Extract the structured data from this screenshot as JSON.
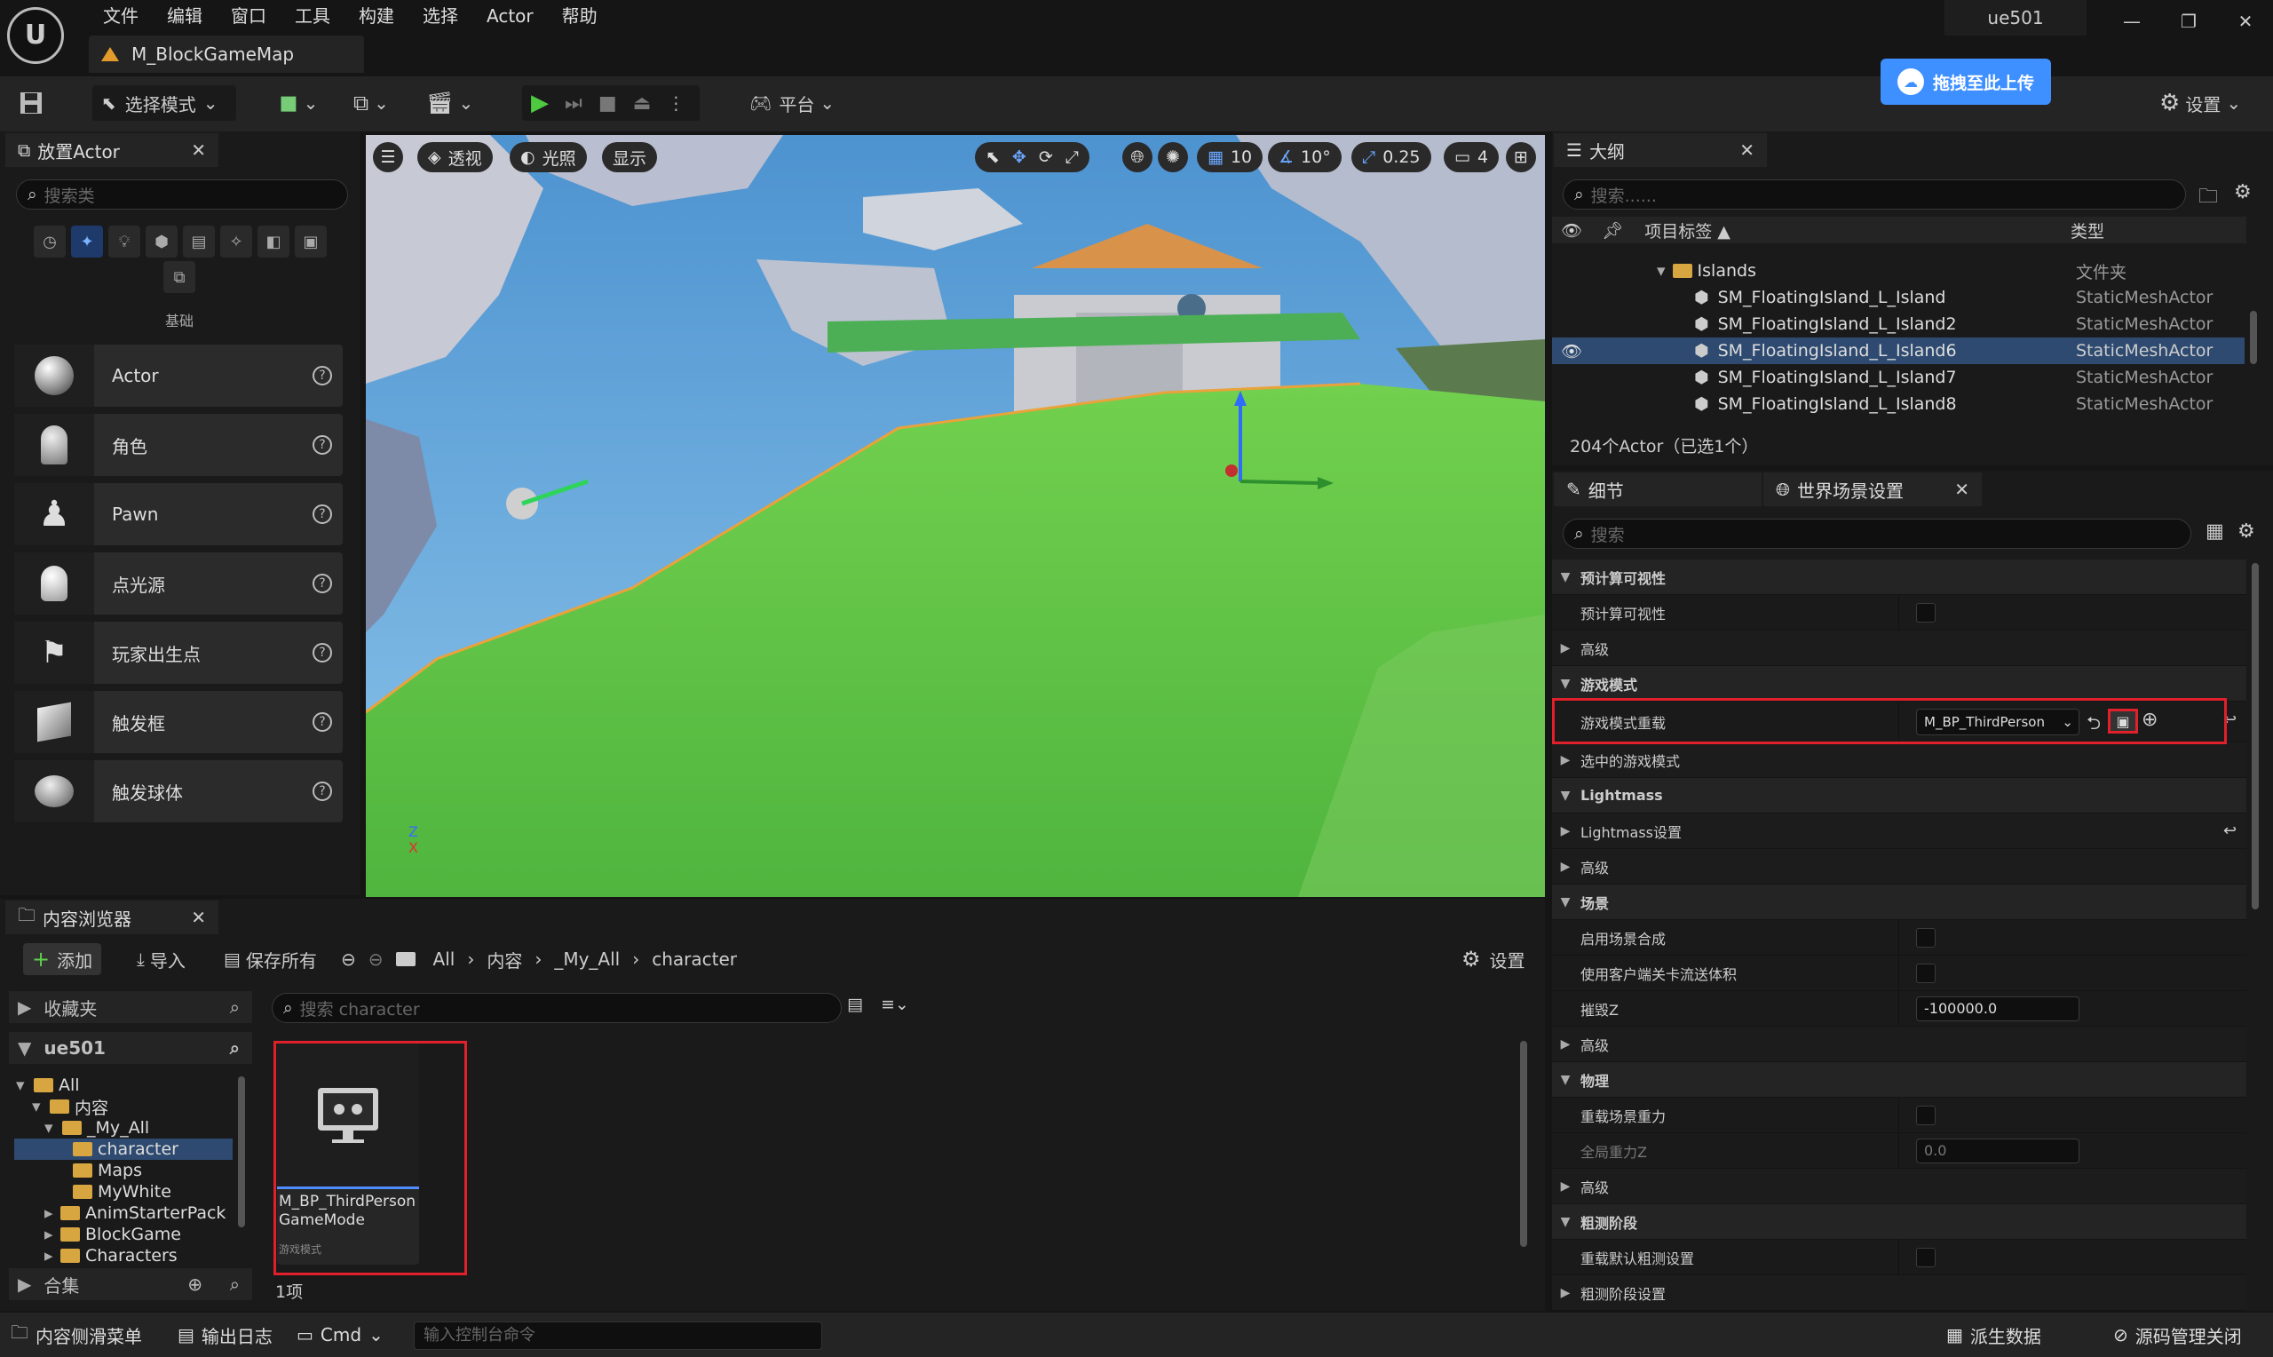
{
  "app": {
    "logo": "U",
    "map_tab": "M_BlockGameMap",
    "user": "ue501"
  },
  "menu": [
    "文件",
    "编辑",
    "窗口",
    "工具",
    "构建",
    "选择",
    "Actor",
    "帮助"
  ],
  "toolbar": {
    "select_mode": "选择模式",
    "platform": "平台",
    "settings": "设置",
    "upload": "拖拽至此上传"
  },
  "place_actor": {
    "tab": "放置Actor",
    "search_placeholder": "搜索类",
    "category_label": "基础",
    "items": [
      "Actor",
      "角色",
      "Pawn",
      "点光源",
      "玩家出生点",
      "触发框",
      "触发球体"
    ]
  },
  "viewport": {
    "perspective": "透视",
    "lighting": "光照",
    "show": "显示",
    "grid": "10",
    "angle": "10°",
    "scale": "0.25",
    "camera": "4"
  },
  "outliner": {
    "tab": "大纲",
    "search_placeholder": "搜索......",
    "col_label": "项目标签 ▲",
    "col_type": "类型",
    "folder": {
      "name": "Islands",
      "type": "文件夹"
    },
    "rows": [
      {
        "name": "SM_FloatingIsland_L_Island",
        "type": "StaticMeshActor"
      },
      {
        "name": "SM_FloatingIsland_L_Island2",
        "type": "StaticMeshActor"
      },
      {
        "name": "SM_FloatingIsland_L_Island6",
        "type": "StaticMeshActor"
      },
      {
        "name": "SM_FloatingIsland_L_Island7",
        "type": "StaticMeshActor"
      },
      {
        "name": "SM_FloatingIsland_L_Island8",
        "type": "StaticMeshActor"
      }
    ],
    "status": "204个Actor（已选1个）"
  },
  "details": {
    "tab": "细节",
    "world_tab": "世界场景设置",
    "search_placeholder": "搜索",
    "rows": {
      "precomp_vis": "预计算可视性",
      "precomp_vis_prop": "预计算可视性",
      "advanced1": "高级",
      "game_mode": "游戏模式",
      "game_mode_override": "游戏模式重载",
      "game_mode_value": "M_BP_ThirdPerson",
      "selected_game_mode": "选中的游戏模式",
      "lightmass": "Lightmass",
      "lightmass_settings": "Lightmass设置",
      "advanced2": "高级",
      "scene": "场景",
      "world_comp": "启用场景合成",
      "client_streaming": "使用客户端关卡流送体积",
      "kill_z": "摧毁Z",
      "kill_z_value": "-100000.0",
      "advanced3": "高级",
      "physics": "物理",
      "override_gravity": "重载场景重力",
      "global_gravity_z": "全局重力Z",
      "gravity_value": "0.0",
      "advanced4": "高级",
      "broadphase": "粗测阶段",
      "override_broadphase": "重载默认粗测设置",
      "broadphase_settings": "粗测阶段设置"
    }
  },
  "content_browser": {
    "tab": "内容浏览器",
    "add": "添加",
    "import": "导入",
    "save_all": "保存所有",
    "path": [
      "All",
      "内容",
      "_My_All",
      "character"
    ],
    "settings": "设置",
    "favorites": "收藏夹",
    "project": "ue501",
    "search_placeholder": "搜索 character",
    "tree": [
      "All",
      "内容",
      "_My_All",
      "character",
      "Maps",
      "MyWhite",
      "AnimStarterPack",
      "BlockGame",
      "Characters"
    ],
    "collections": "合集",
    "asset_name_1": "M_BP_ThirdPerson",
    "asset_name_2": "GameMode",
    "asset_type": "游戏模式",
    "item_count": "1项"
  },
  "statusbar": {
    "drawer": "内容侧滑菜单",
    "output": "输出日志",
    "cmd": "Cmd",
    "console_placeholder": "输入控制台命令",
    "derived": "派生数据",
    "source_control": "源码管理关闭"
  },
  "colors": {
    "accent": "#e0202a",
    "selection": "#2e4a70",
    "grass": "#63c545",
    "sky": "#5aa0d6"
  }
}
